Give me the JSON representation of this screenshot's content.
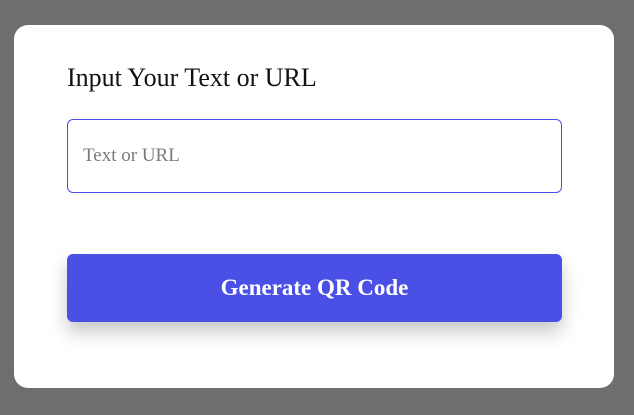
{
  "form": {
    "title": "Input Your Text or URL",
    "input": {
      "value": "",
      "placeholder": "Text or URL"
    },
    "button_label": "Generate QR Code"
  },
  "colors": {
    "background": "#6e6e6e",
    "card": "#ffffff",
    "accent": "#4a4fe6",
    "button_text": "#ffffff"
  }
}
